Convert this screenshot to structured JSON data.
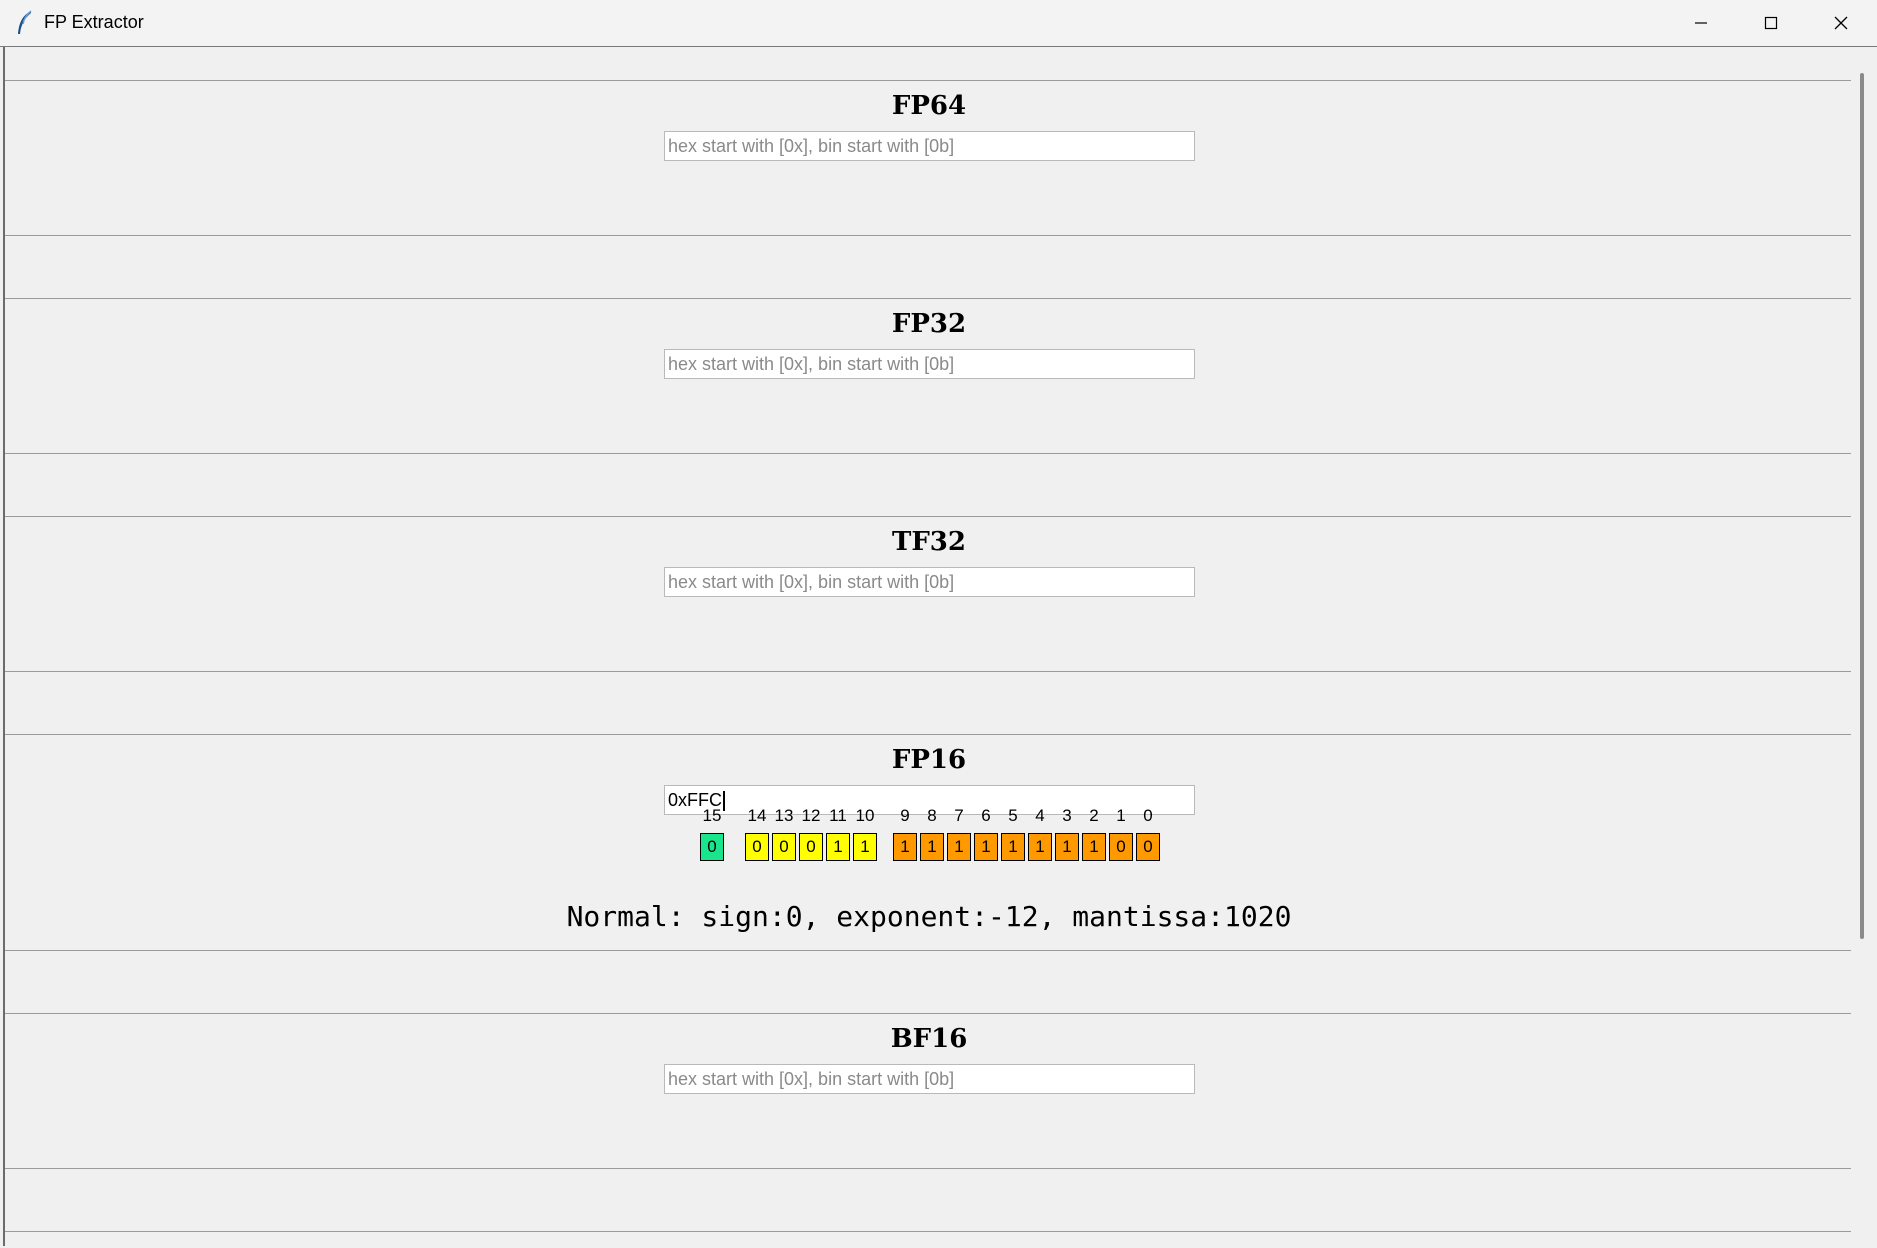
{
  "window": {
    "title": "FP Extractor"
  },
  "sections": [
    {
      "title": "FP64",
      "placeholder": "hex start with [0x], bin start with [0b]"
    },
    {
      "title": "FP32",
      "placeholder": "hex start with [0x], bin start with [0b]"
    },
    {
      "title": "TF32",
      "placeholder": "hex start with [0x], bin start with [0b]"
    },
    {
      "title": "FP16",
      "value": "0xFFC"
    },
    {
      "title": "BF16",
      "placeholder": "hex start with [0x], bin start with [0b]"
    }
  ],
  "fp16": {
    "bit_indices": [
      "15",
      "14",
      "13",
      "12",
      "11",
      "10",
      "9",
      "8",
      "7",
      "6",
      "5",
      "4",
      "3",
      "2",
      "1",
      "0"
    ],
    "bits": [
      "0",
      "0",
      "0",
      "0",
      "1",
      "1",
      "1",
      "1",
      "1",
      "1",
      "1",
      "1",
      "1",
      "1",
      "0",
      "0"
    ],
    "result": "Normal: sign:0, exponent:-12, mantissa:1020"
  },
  "colors": {
    "sign": "#19e68c",
    "exponent": "#ffff00",
    "mantissa": "#ff9900"
  },
  "icons": [
    "feather-icon",
    "minimize-icon",
    "maximize-icon",
    "close-icon"
  ]
}
